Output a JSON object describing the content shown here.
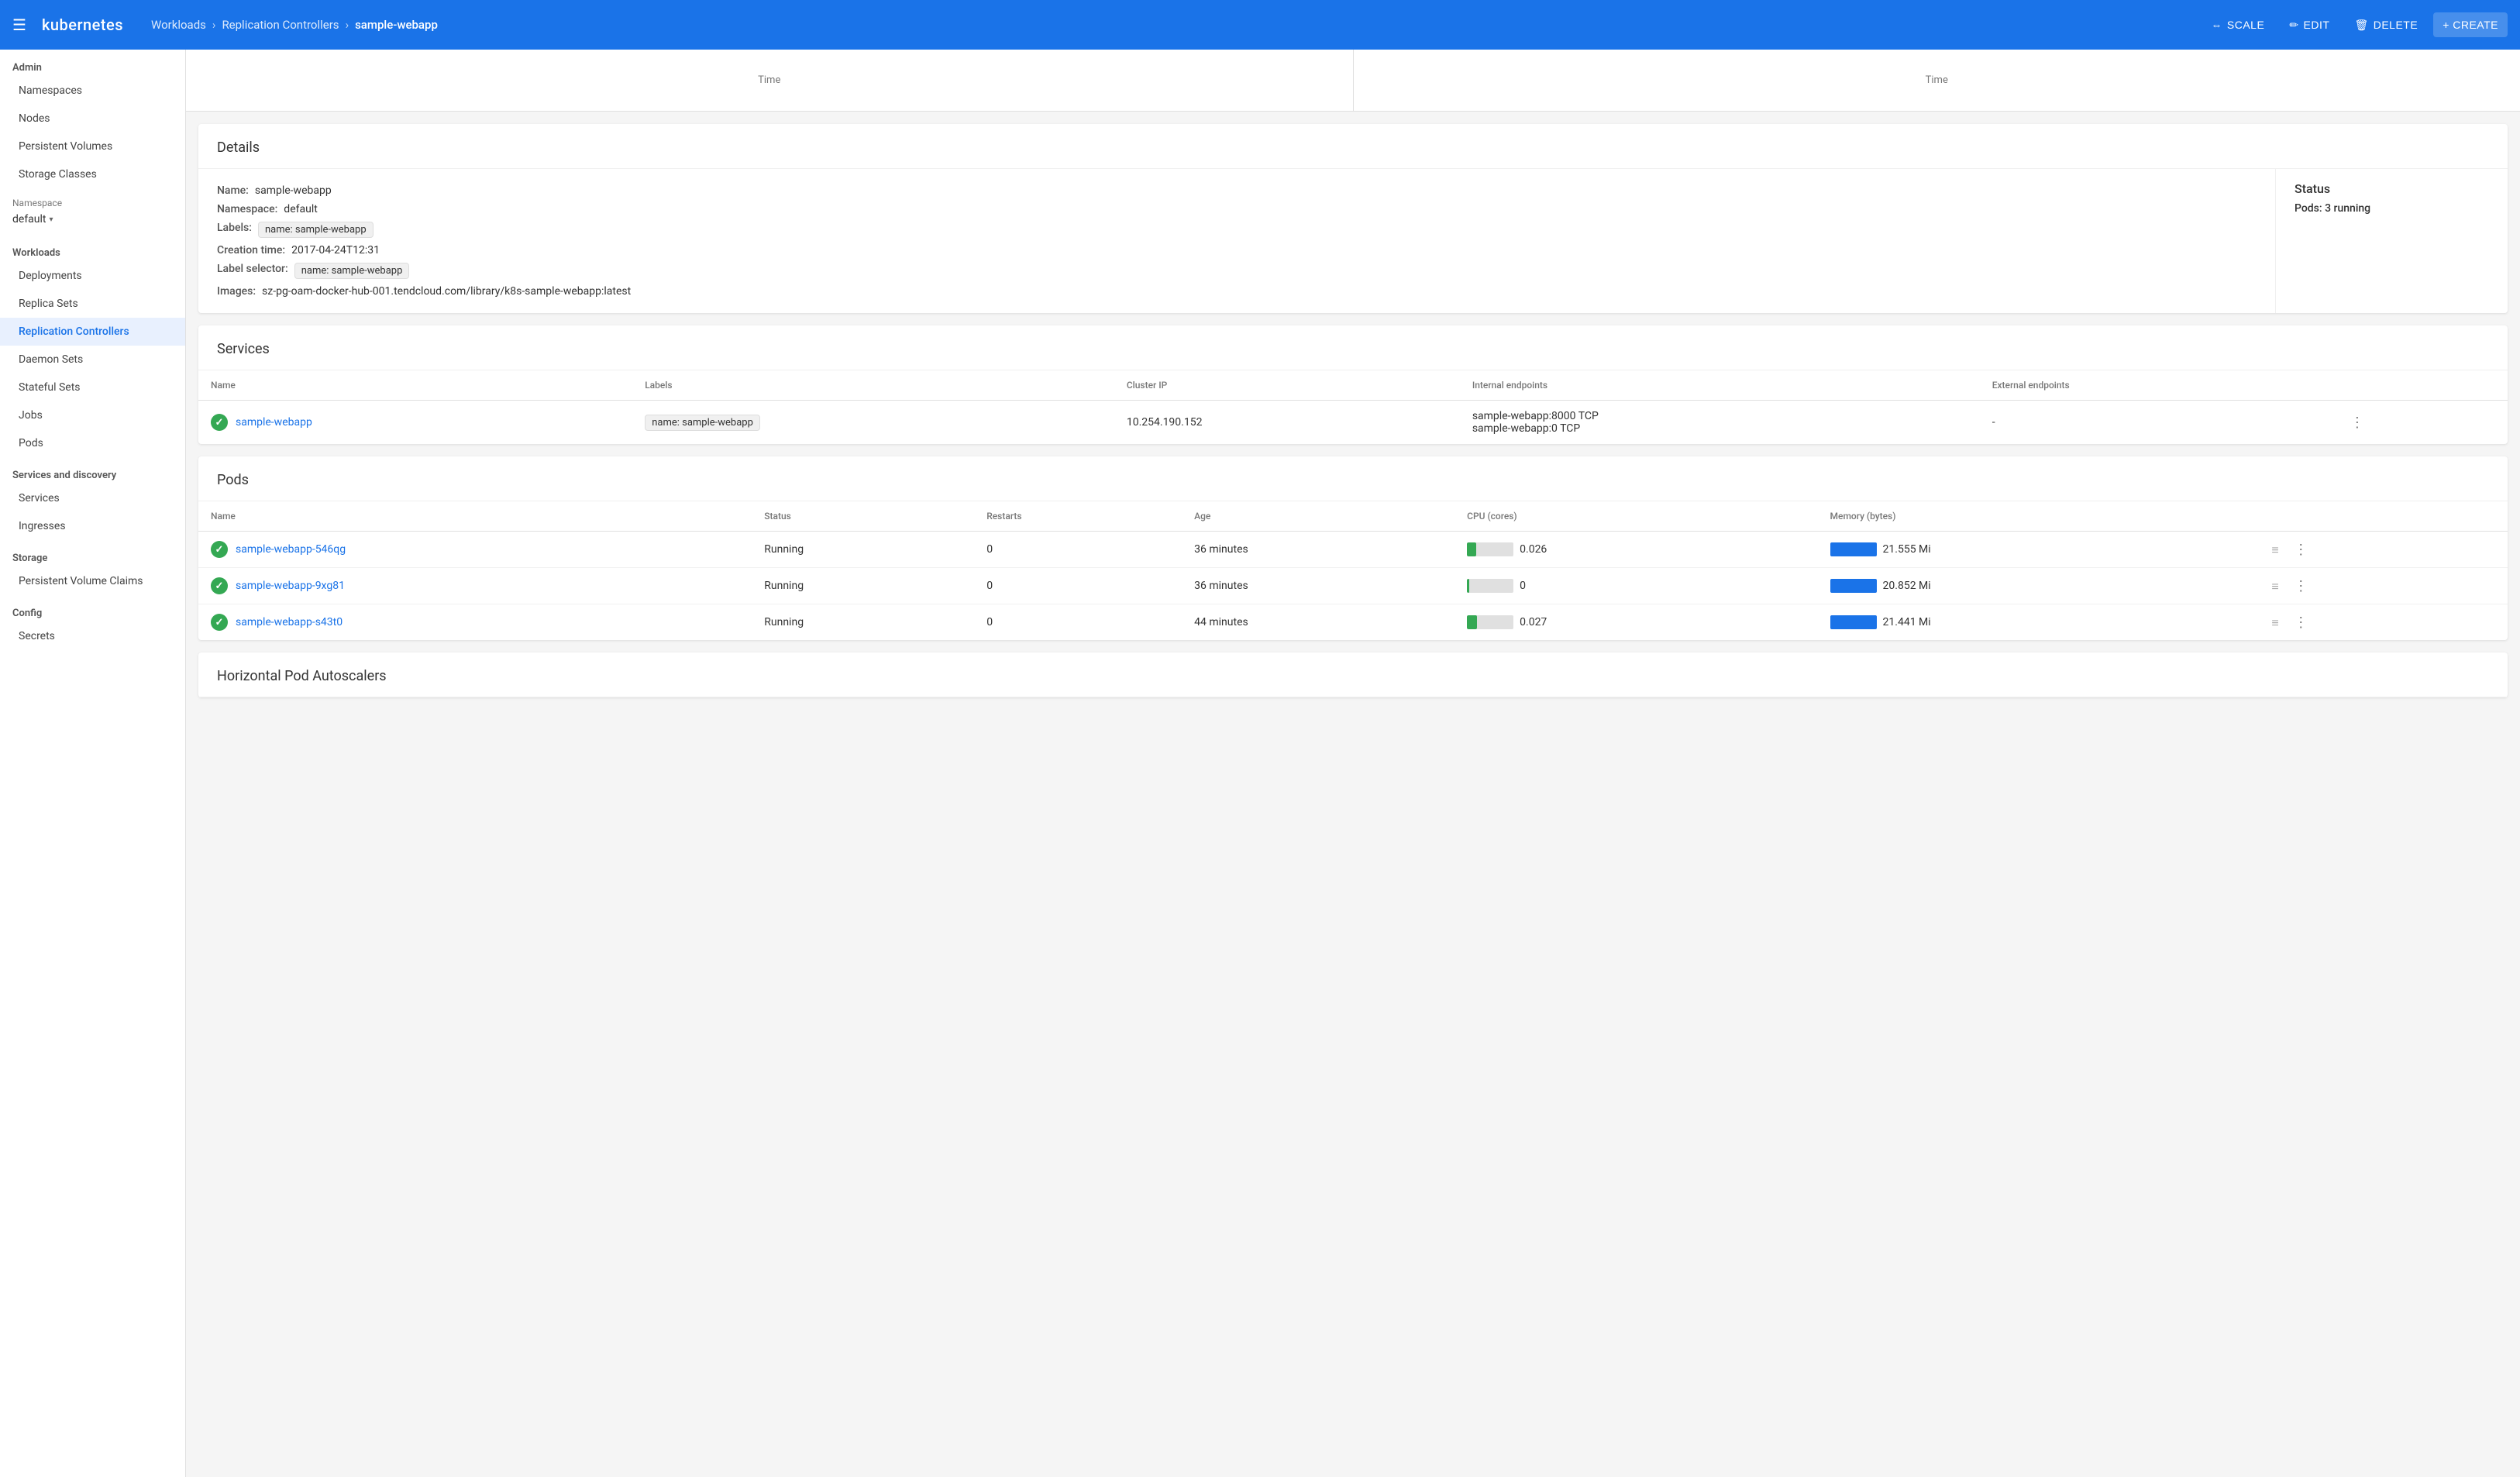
{
  "topnav": {
    "menu_icon": "☰",
    "logo": "kubernetes",
    "breadcrumb": {
      "workloads": "Workloads",
      "replication_controllers": "Replication Controllers",
      "current": "sample-webapp"
    },
    "actions": {
      "scale": "SCALE",
      "edit": "EDIT",
      "delete": "DELETE",
      "create": "+ CREATE"
    }
  },
  "sidebar": {
    "admin_header": "Admin",
    "admin_items": [
      "Namespaces",
      "Nodes",
      "Persistent Volumes",
      "Storage Classes"
    ],
    "namespace_label": "Namespace",
    "namespace_value": "default",
    "workloads_header": "Workloads",
    "workloads_items": [
      "Deployments",
      "Replica Sets",
      "Replication Controllers",
      "Daemon Sets",
      "Stateful Sets",
      "Jobs",
      "Pods"
    ],
    "services_header": "Services and discovery",
    "services_items": [
      "Services",
      "Ingresses"
    ],
    "storage_header": "Storage",
    "storage_items": [
      "Persistent Volume Claims"
    ],
    "config_header": "Config",
    "config_items": [
      "Secrets"
    ]
  },
  "chart": {
    "left_label": "Time",
    "right_label": "Time"
  },
  "details": {
    "title": "Details",
    "name_label": "Name:",
    "name_value": "sample-webapp",
    "namespace_label": "Namespace:",
    "namespace_value": "default",
    "labels_label": "Labels:",
    "labels_value": "name: sample-webapp",
    "creation_label": "Creation time:",
    "creation_value": "2017-04-24T12:31",
    "selector_label": "Label selector:",
    "selector_value": "name: sample-webapp",
    "images_label": "Images:",
    "images_value": "sz-pg-oam-docker-hub-001.tendcloud.com/library/k8s-sample-webapp:latest",
    "status_title": "Status",
    "pods_label": "Pods:",
    "pods_value": "3 running"
  },
  "services": {
    "title": "Services",
    "columns": [
      "Name",
      "Labels",
      "Cluster IP",
      "Internal endpoints",
      "External endpoints"
    ],
    "rows": [
      {
        "name": "sample-webapp",
        "label": "name: sample-webapp",
        "cluster_ip": "10.254.190.152",
        "internal_endpoints": "sample-webapp:8000 TCP\nsample-webapp:0 TCP",
        "external_endpoints": "-"
      }
    ]
  },
  "pods": {
    "title": "Pods",
    "columns": [
      "Name",
      "Status",
      "Restarts",
      "Age",
      "CPU (cores)",
      "Memory (bytes)"
    ],
    "rows": [
      {
        "name": "sample-webapp-546qg",
        "status": "Running",
        "restarts": "0",
        "age": "36 minutes",
        "cpu_value": "0.026",
        "cpu_pct": 20,
        "memory_value": "21.555 Mi"
      },
      {
        "name": "sample-webapp-9xg81",
        "status": "Running",
        "restarts": "0",
        "age": "36 minutes",
        "cpu_value": "0",
        "cpu_pct": 5,
        "memory_value": "20.852 Mi"
      },
      {
        "name": "sample-webapp-s43t0",
        "status": "Running",
        "restarts": "0",
        "age": "44 minutes",
        "cpu_value": "0.027",
        "cpu_pct": 22,
        "memory_value": "21.441 Mi"
      }
    ]
  },
  "autoscalers": {
    "title": "Horizontal Pod Autoscalers"
  }
}
